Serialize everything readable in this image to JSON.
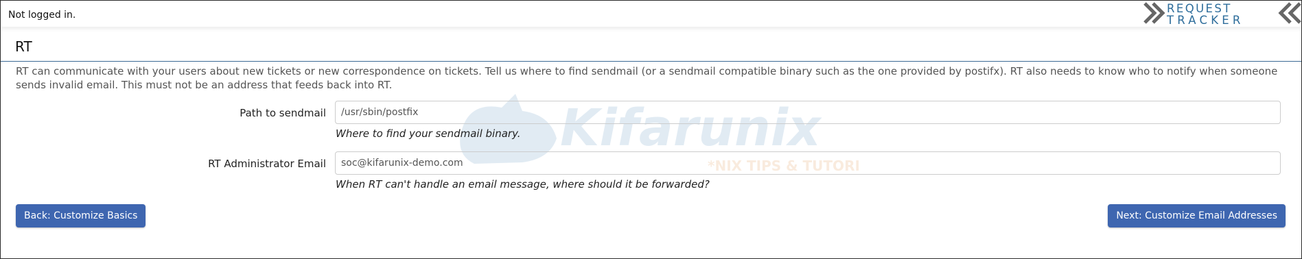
{
  "header": {
    "login_status": "Not logged in.",
    "logo_text_line1": "REQUEST",
    "logo_text_line2": "TRACKER"
  },
  "page": {
    "title": "RT",
    "intro": "RT can communicate with your users about new tickets or new correspondence on tickets. Tell us where to find sendmail (or a sendmail compatible binary such as the one provided by postifx). RT also needs to know who to notify when someone sends invalid email. This must not be an address that feeds back into RT."
  },
  "form": {
    "sendmail_path": {
      "label": "Path to sendmail",
      "value": "/usr/sbin/postfix",
      "hint": "Where to find your sendmail binary."
    },
    "admin_email": {
      "label": "RT Administrator Email",
      "value": "soc@kifarunix-demo.com",
      "hint": "When RT can't handle an email message, where should it be forwarded?"
    }
  },
  "actions": {
    "back_label": "Back: Customize Basics",
    "next_label": "Next: Customize Email Addresses"
  },
  "watermark": {
    "brand": "Kifarunix",
    "tagline": "*NIX TIPS & TUTORIALS"
  },
  "colors": {
    "accent": "#3e66b0",
    "logo": "#2e6d9b",
    "divider": "#3c6a94"
  }
}
